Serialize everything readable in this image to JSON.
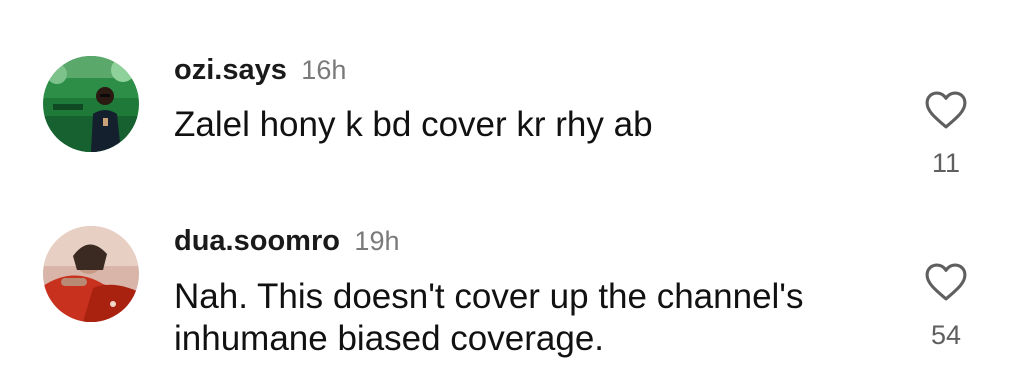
{
  "comments": [
    {
      "username": "ozi.says",
      "time": "16h",
      "text": "Zalel hony k bd cover kr rhy ab",
      "likes": "11"
    },
    {
      "username": "dua.soomro",
      "time": "19h",
      "text": "Nah. This doesn't cover up the channel's inhumane biased coverage.",
      "likes": "54"
    }
  ],
  "icons": {
    "like": "heart-outline-icon"
  },
  "colors": {
    "text": "#111111",
    "secondary": "#7a7a7a",
    "icon": "#5f5f5f"
  }
}
